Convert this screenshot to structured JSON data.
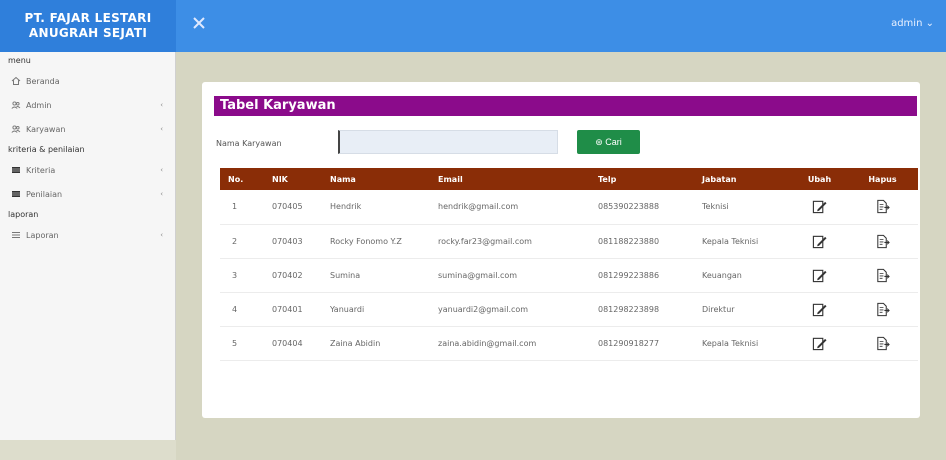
{
  "brand": {
    "line1": "PT. FAJAR LESTARI",
    "line2": "ANUGRAH SEJATI"
  },
  "user": {
    "name": "admin",
    "caret": "⌄"
  },
  "sidebar": {
    "sections": [
      {
        "heading": "menu",
        "items": [
          {
            "label": "Beranda",
            "icon": "home-icon",
            "chevron": ""
          },
          {
            "label": "Admin",
            "icon": "users-icon",
            "chevron": "‹"
          },
          {
            "label": "Karyawan",
            "icon": "users-icon",
            "chevron": "‹"
          }
        ]
      },
      {
        "heading": "kriteria & penilaian",
        "items": [
          {
            "label": "Kriteria",
            "icon": "grid-icon",
            "chevron": "‹"
          },
          {
            "label": "Penilaian",
            "icon": "grid-icon",
            "chevron": "‹"
          }
        ]
      },
      {
        "heading": "laporan",
        "items": [
          {
            "label": "Laporan",
            "icon": "list-icon",
            "chevron": "‹"
          }
        ]
      }
    ]
  },
  "card": {
    "title": "Tabel Karyawan",
    "search_label": "Nama Karyawan",
    "search_value": "",
    "search_button": "⊛ Cari"
  },
  "table": {
    "headers": [
      "No.",
      "NIK",
      "Nama",
      "Email",
      "Telp",
      "Jabatan",
      "Ubah",
      "Hapus"
    ],
    "rows": [
      [
        "1",
        "070405",
        "Hendrik",
        "hendrik@gmail.com",
        "085390223888",
        "Teknisi"
      ],
      [
        "2",
        "070403",
        "Rocky Fonomo Y.Z",
        "rocky.far23@gmail.com",
        "081188223880",
        "Kepala Teknisi"
      ],
      [
        "3",
        "070402",
        "Sumina",
        "sumina@gmail.com",
        "081299223886",
        "Keuangan"
      ],
      [
        "4",
        "070401",
        "Yanuardi",
        "yanuardi2@gmail.com",
        "081298223898",
        "Direktur"
      ],
      [
        "5",
        "070404",
        "Zaina Abidin",
        "zaina.abidin@gmail.com",
        "081290918277",
        "Kepala Teknisi"
      ]
    ]
  },
  "colors": {
    "topbar": "#3d8ee6",
    "title_bar": "#8b0b8b",
    "table_header": "#8a2d07",
    "search_button": "#1f8d48"
  }
}
